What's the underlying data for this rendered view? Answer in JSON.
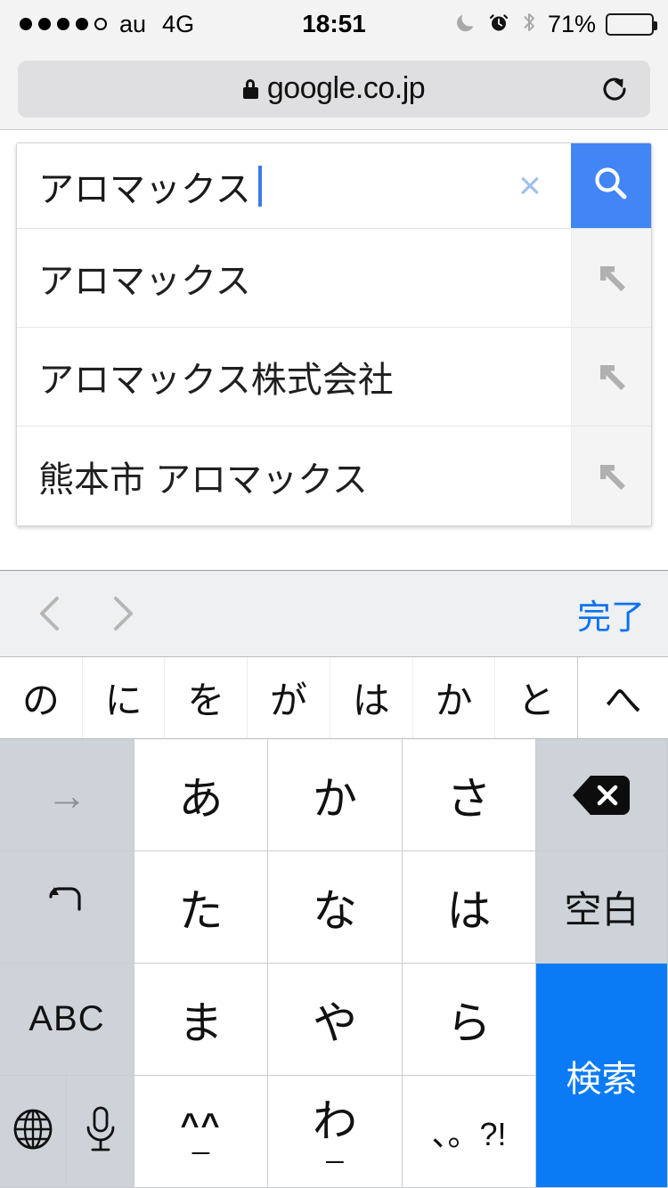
{
  "status_bar": {
    "signal_dots_filled": 4,
    "signal_dots_total": 5,
    "carrier": "au",
    "network": "4G",
    "time": "18:51",
    "battery_percent": "71%",
    "battery_level": 71,
    "icons": [
      "moon-icon",
      "alarm-icon",
      "bluetooth-icon"
    ]
  },
  "browser": {
    "url": "google.co.jp",
    "secure": true,
    "reload_icon": "reload-icon"
  },
  "search": {
    "query": "アロマックス",
    "clear_label": "×",
    "search_icon": "magnifier-icon",
    "suggestions": [
      {
        "text": "アロマックス",
        "arrow_icon": "arrow-up-left-icon"
      },
      {
        "text": "アロマックス株式会社",
        "arrow_icon": "arrow-up-left-icon"
      },
      {
        "text": "熊本市  アロマックス",
        "arrow_icon": "arrow-up-left-icon"
      }
    ]
  },
  "keyboard": {
    "toolbar": {
      "prev_icon": "chevron-left-icon",
      "next_icon": "chevron-right-icon",
      "done_label": "完了",
      "done_color": "#0b72ef"
    },
    "candidates": [
      "の",
      "に",
      "を",
      "が",
      "は",
      "か",
      "と"
    ],
    "candidates_expand": "へ",
    "rows": [
      [
        {
          "name": "cursor-right-key",
          "label": "→",
          "style": "fn"
        },
        {
          "name": "a-row-key",
          "label": "あ",
          "style": "letter"
        },
        {
          "name": "ka-row-key",
          "label": "か",
          "style": "letter"
        },
        {
          "name": "sa-row-key",
          "label": "さ",
          "style": "letter"
        },
        {
          "name": "delete-key",
          "label": "",
          "style": "fn-icon",
          "icon": "backspace-icon"
        }
      ],
      [
        {
          "name": "undo-key",
          "label": "↺",
          "style": "fn"
        },
        {
          "name": "ta-row-key",
          "label": "た",
          "style": "letter"
        },
        {
          "name": "na-row-key",
          "label": "な",
          "style": "letter"
        },
        {
          "name": "ha-row-key",
          "label": "は",
          "style": "letter"
        },
        {
          "name": "space-key",
          "label": "空白",
          "style": "fn-text"
        }
      ],
      [
        {
          "name": "abc-key",
          "label": "ABC",
          "style": "fn-abc"
        },
        {
          "name": "ma-row-key",
          "label": "ま",
          "style": "letter"
        },
        {
          "name": "ya-row-key",
          "label": "や",
          "style": "letter"
        },
        {
          "name": "ra-row-key",
          "label": "ら",
          "style": "letter"
        },
        {
          "name": "search-key",
          "label": "検索",
          "style": "blue-span2"
        }
      ],
      [
        {
          "name": "globe-key",
          "label": "",
          "style": "half-icon",
          "icon": "globe-icon"
        },
        {
          "name": "dictation-key",
          "label": "",
          "style": "half-icon",
          "icon": "microphone-icon"
        },
        {
          "name": "emoticon-key",
          "label": "^^",
          "sub": "_",
          "style": "kao"
        },
        {
          "name": "wa-row-key",
          "label": "わ",
          "sub": "_",
          "style": "letter-sub"
        },
        {
          "name": "punctuation-key",
          "label": "、。?!",
          "style": "punct"
        }
      ]
    ]
  },
  "colors": {
    "accent_blue": "#0a7bf5",
    "google_blue": "#4285f4",
    "key_fn": "#ced3d9",
    "keyboard_bg": "#d1d4da",
    "toolbar_bg": "#eff0f2"
  }
}
